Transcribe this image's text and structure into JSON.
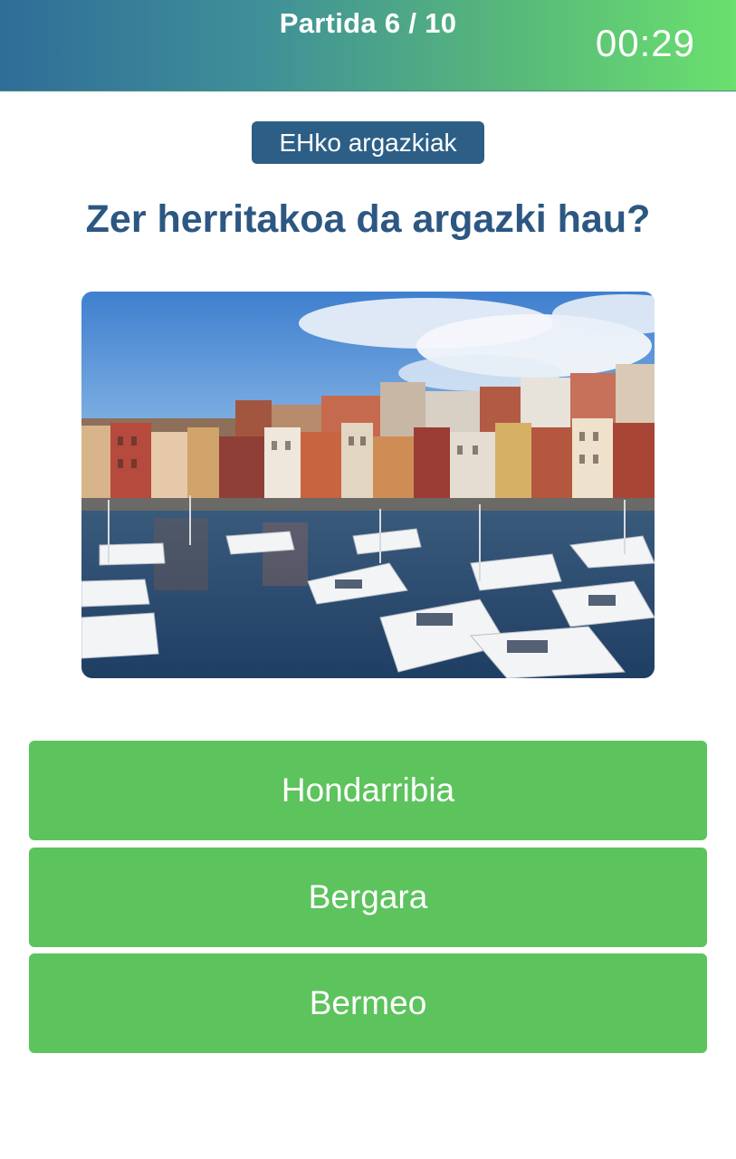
{
  "header": {
    "title": "Partida 6 / 10",
    "timer": "00:29"
  },
  "category": {
    "label": "EHko argazkiak"
  },
  "question": {
    "text": "Zer herritakoa da argazki hau?"
  },
  "photo": {
    "subject": "harbour-with-boats-and-colorful-buildings"
  },
  "answers": [
    {
      "label": "Hondarribia"
    },
    {
      "label": "Bergara"
    },
    {
      "label": "Bermeo"
    }
  ],
  "colors": {
    "header_gradient_start": "#2f6d98",
    "header_gradient_end": "#6ae06e",
    "badge": "#2d5f86",
    "question_text": "#2c5782",
    "answer_button": "#5cc35d"
  }
}
